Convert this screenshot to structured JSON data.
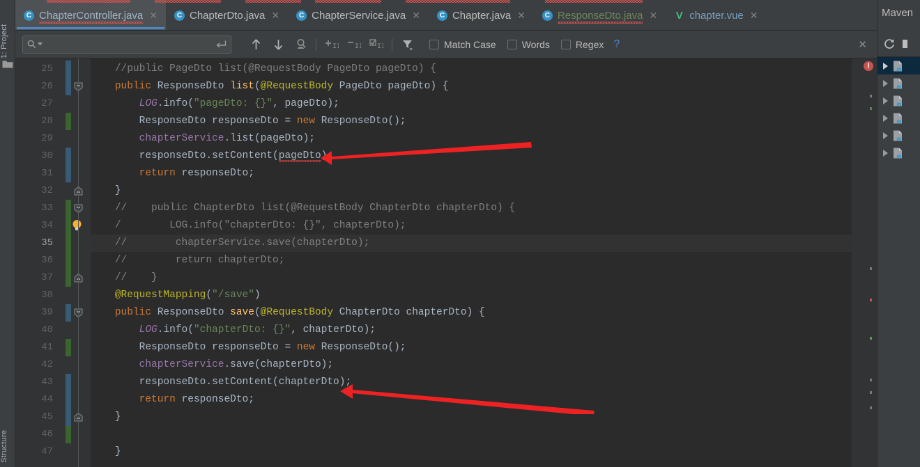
{
  "window": {
    "left_strip": {
      "project_label": "1: Project",
      "structure_label": "Structure",
      "folder_icon": "folder-icon"
    },
    "maven_panel": {
      "title": "Maven",
      "refresh_icon": "refresh-icon",
      "more_icon": "more-icon",
      "rows": [
        {
          "expand_icon": "chevron-right-icon",
          "file_icon": "maven-module-icon",
          "selected": true
        },
        {
          "expand_icon": "chevron-right-icon",
          "file_icon": "maven-module-icon",
          "selected": false
        },
        {
          "expand_icon": "chevron-right-icon",
          "file_icon": "maven-module-icon",
          "selected": false
        },
        {
          "expand_icon": "chevron-right-icon",
          "file_icon": "maven-module-icon",
          "selected": false
        },
        {
          "expand_icon": "chevron-right-icon",
          "file_icon": "maven-module-icon",
          "selected": false
        },
        {
          "expand_icon": "chevron-right-icon",
          "file_icon": "maven-module-icon",
          "selected": false
        }
      ]
    }
  },
  "tabs": [
    {
      "label": "ChapterController.java",
      "icon": "java-class-icon",
      "icon_letter": "C",
      "active": true,
      "color": "active",
      "error": true,
      "close_icon": "close-icon"
    },
    {
      "label": "ChapterDto.java",
      "icon": "java-class-icon",
      "icon_letter": "C",
      "active": false,
      "color": "normal",
      "error": false,
      "close_icon": "close-icon"
    },
    {
      "label": "ChapterService.java",
      "icon": "java-class-icon",
      "icon_letter": "C",
      "active": false,
      "color": "normal",
      "error": false,
      "close_icon": "close-icon"
    },
    {
      "label": "Chapter.java",
      "icon": "java-class-icon",
      "icon_letter": "C",
      "active": false,
      "color": "normal",
      "error": false,
      "close_icon": "close-icon"
    },
    {
      "label": "ResponseDto.java",
      "icon": "java-class-icon",
      "icon_letter": "C",
      "active": false,
      "color": "green",
      "error": true,
      "close_icon": "close-icon"
    },
    {
      "label": "chapter.vue",
      "icon": "vue-file-icon",
      "icon_letter": "V",
      "active": false,
      "color": "blue",
      "error": false,
      "close_icon": "close-icon"
    }
  ],
  "findbar": {
    "search_value": "",
    "search_placeholder": "",
    "search_icon": "search-icon",
    "search_dropdown_icon": "chevron-down-icon",
    "multiline_icon": "multiline-toggle-icon",
    "prev_icon": "arrow-up-icon",
    "next_icon": "arrow-down-icon",
    "find_all_icon": "find-all-icon",
    "add_occurrence_icon": "add-selection-icon",
    "remove_occurrence_icon": "remove-selection-icon",
    "select_all_occurrences_icon": "select-all-occurrences-icon",
    "filter_icon": "filter-icon",
    "close_icon": "close-icon",
    "options": [
      {
        "label": "Match Case",
        "mnemonic": "C",
        "checked": false
      },
      {
        "label": "Words",
        "mnemonic": "o",
        "checked": false
      },
      {
        "label": "Regex",
        "mnemonic": "x",
        "checked": false
      }
    ],
    "help_label": "?"
  },
  "editor": {
    "error_badge": "!",
    "first_line": 25,
    "cursor_line": 35,
    "lines": [
      {
        "n": 25,
        "vcs": "mod",
        "fold": null,
        "bulb": false,
        "html": "<span class=\"cmt\">//public PageDto list(@RequestBody PageDto pageDto) {</span>",
        "text": "//public PageDto list(@RequestBody PageDto pageDto) {"
      },
      {
        "n": 26,
        "vcs": "mod",
        "fold": "collapse",
        "bulb": false,
        "html": "<span class=\"kw\">public</span> <span class=\"typ\">ResponseDto</span> <span class=\"mth\">list</span>(<span class=\"ann\">@RequestBody</span> <span class=\"typ\">PageDto</span> pageDto) {",
        "text": "public ResponseDto list(@RequestBody PageDto pageDto) {"
      },
      {
        "n": 27,
        "vcs": null,
        "fold": null,
        "bulb": false,
        "html": "    <span class=\"stat\">LOG</span>.info(<span class=\"str\">\"pageDto: {}\"</span>, pageDto);",
        "text": "LOG.info(\"pageDto: {}\", pageDto);"
      },
      {
        "n": 28,
        "vcs": "add",
        "fold": null,
        "bulb": false,
        "html": "    <span class=\"typ\">ResponseDto</span> responseDto = <span class=\"kw\">new</span> <span class=\"typ\">ResponseDto</span>();",
        "text": "ResponseDto responseDto = new ResponseDto();"
      },
      {
        "n": 29,
        "vcs": null,
        "fold": null,
        "bulb": false,
        "html": "    <span class=\"fld\">chapterService</span>.list(pageDto);",
        "text": "chapterService.list(pageDto);"
      },
      {
        "n": 30,
        "vcs": "mod",
        "fold": null,
        "bulb": false,
        "html": "    responseDto.setContent(<span class=\"err-squiggle\">pageDto</span>);",
        "text": "responseDto.setContent(pageDto);"
      },
      {
        "n": 31,
        "vcs": "mod",
        "fold": null,
        "bulb": false,
        "html": "    <span class=\"kw\">return</span> responseDto;",
        "text": "return responseDto;"
      },
      {
        "n": 32,
        "vcs": null,
        "fold": "end",
        "bulb": false,
        "html": "}",
        "text": "}"
      },
      {
        "n": 33,
        "vcs": "add",
        "fold": "collapse",
        "bulb": false,
        "html": "<span class=\"cmt\">//    public ChapterDto list(@RequestBody ChapterDto chapterDto) {</span>",
        "text": "//    public ChapterDto list(@RequestBody ChapterDto chapterDto) {"
      },
      {
        "n": 34,
        "vcs": "add",
        "fold": null,
        "bulb": true,
        "html": "<span class=\"cmt\">/        LOG.info(\"chapterDto: {}\", chapterDto);</span>",
        "text": "//        LOG.info(\"chapterDto: {}\", chapterDto);"
      },
      {
        "n": 35,
        "vcs": "add",
        "fold": null,
        "bulb": false,
        "html": "<span class=\"cmt\">//        chapterService.save(chapterDto);</span>",
        "text": "//        chapterService.save(chapterDto);"
      },
      {
        "n": 36,
        "vcs": "add",
        "fold": null,
        "bulb": false,
        "html": "<span class=\"cmt\">//        return chapterDto;</span>",
        "text": "//        return chapterDto;"
      },
      {
        "n": 37,
        "vcs": "add",
        "fold": "end",
        "bulb": false,
        "html": "<span class=\"cmt\">//    }</span>",
        "text": "//    }"
      },
      {
        "n": 38,
        "vcs": null,
        "fold": null,
        "bulb": false,
        "html": "<span class=\"ann\">@RequestMapping</span>(<span class=\"str\">\"/save\"</span>)",
        "text": "@RequestMapping(\"/save\")"
      },
      {
        "n": 39,
        "vcs": "mod",
        "fold": "collapse",
        "bulb": false,
        "html": "<span class=\"kw\">public</span> <span class=\"typ\">ResponseDto</span> <span class=\"mth\">save</span>(<span class=\"ann\">@RequestBody</span> <span class=\"typ\">ChapterDto</span> chapterDto) {",
        "text": "public ResponseDto save(@RequestBody ChapterDto chapterDto) {"
      },
      {
        "n": 40,
        "vcs": null,
        "fold": null,
        "bulb": false,
        "html": "    <span class=\"stat\">LOG</span>.info(<span class=\"str\">\"chapterDto: {}\"</span>, chapterDto);",
        "text": "LOG.info(\"chapterDto: {}\", chapterDto);"
      },
      {
        "n": 41,
        "vcs": "add",
        "fold": null,
        "bulb": false,
        "html": "    <span class=\"typ\">ResponseDto</span> responseDto = <span class=\"kw\">new</span> <span class=\"typ\">ResponseDto</span>();",
        "text": "ResponseDto responseDto = new ResponseDto();"
      },
      {
        "n": 42,
        "vcs": null,
        "fold": null,
        "bulb": false,
        "html": "    <span class=\"fld\">chapterService</span>.save(chapterDto);",
        "text": "chapterService.save(chapterDto);"
      },
      {
        "n": 43,
        "vcs": "mod",
        "fold": null,
        "bulb": false,
        "html": "    responseDto.setContent(chapterDto);",
        "text": "responseDto.setContent(chapterDto);"
      },
      {
        "n": 44,
        "vcs": "mod",
        "fold": null,
        "bulb": false,
        "html": "    <span class=\"kw\">return</span> responseDto;",
        "text": "return responseDto;"
      },
      {
        "n": 45,
        "vcs": "mod",
        "fold": "end",
        "bulb": false,
        "html": "}",
        "text": "}"
      },
      {
        "n": 46,
        "vcs": "add",
        "fold": null,
        "bulb": false,
        "html": "",
        "text": ""
      },
      {
        "n": 47,
        "vcs": null,
        "fold": null,
        "bulb": false,
        "html": "<span class=\"typ\">}</span>",
        "text": "}"
      }
    ]
  },
  "annotations": {
    "arrow_color": "#ee2222",
    "arrows": [
      {
        "name": "arrow-to-setContent-pageDto",
        "target_line": 30
      },
      {
        "name": "arrow-to-setContent-chapterDto",
        "target_line": 43
      }
    ]
  },
  "colors": {
    "background": "#2b2b2b",
    "chrome": "#3c3f41",
    "gutter": "#313335",
    "accent_tab": "#4a88c7",
    "keyword": "#cc7832",
    "string": "#6a8759",
    "annotation": "#bbb529",
    "method": "#ffc66d",
    "field": "#9876aa",
    "comment": "#808080",
    "error": "#bc3f3c"
  }
}
